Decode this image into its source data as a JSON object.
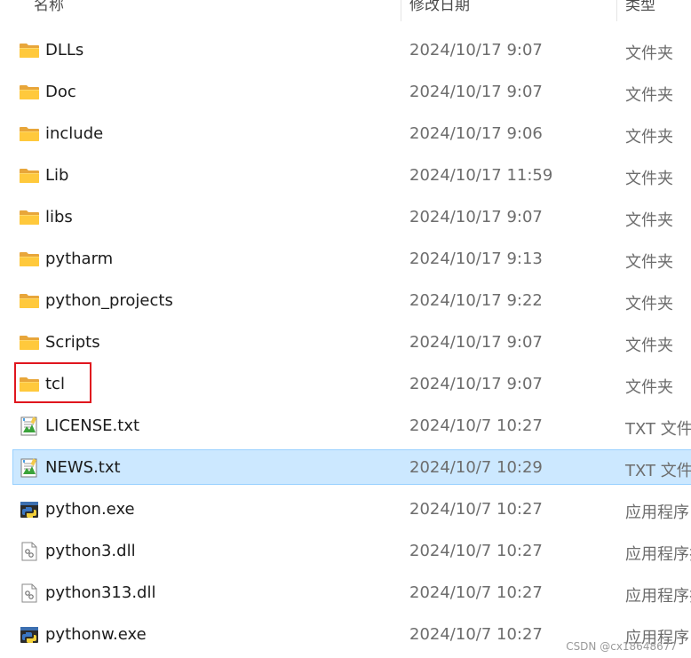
{
  "columns": {
    "name": "名称",
    "date": "修改日期",
    "type": "类型"
  },
  "files": [
    {
      "name": "DLLs",
      "date": "2024/10/17 9:07",
      "type": "文件夹",
      "icon": "folder-icon",
      "selected": false
    },
    {
      "name": "Doc",
      "date": "2024/10/17 9:07",
      "type": "文件夹",
      "icon": "folder-icon",
      "selected": false
    },
    {
      "name": "include",
      "date": "2024/10/17 9:06",
      "type": "文件夹",
      "icon": "folder-icon",
      "selected": false
    },
    {
      "name": "Lib",
      "date": "2024/10/17 11:59",
      "type": "文件夹",
      "icon": "folder-icon",
      "selected": false
    },
    {
      "name": "libs",
      "date": "2024/10/17 9:07",
      "type": "文件夹",
      "icon": "folder-icon",
      "selected": false
    },
    {
      "name": "pytharm",
      "date": "2024/10/17 9:13",
      "type": "文件夹",
      "icon": "folder-icon",
      "selected": false
    },
    {
      "name": "python_projects",
      "date": "2024/10/17 9:22",
      "type": "文件夹",
      "icon": "folder-icon",
      "selected": false
    },
    {
      "name": "Scripts",
      "date": "2024/10/17 9:07",
      "type": "文件夹",
      "icon": "folder-icon",
      "selected": false
    },
    {
      "name": "tcl",
      "date": "2024/10/17 9:07",
      "type": "文件夹",
      "icon": "folder-icon",
      "selected": false
    },
    {
      "name": "LICENSE.txt",
      "date": "2024/10/7 10:27",
      "type": "TXT 文件",
      "icon": "text-file-icon",
      "selected": false
    },
    {
      "name": "NEWS.txt",
      "date": "2024/10/7 10:29",
      "type": "TXT 文件",
      "icon": "text-file-icon",
      "selected": true
    },
    {
      "name": "python.exe",
      "date": "2024/10/7 10:27",
      "type": "应用程序",
      "icon": "python-exe-icon",
      "selected": false
    },
    {
      "name": "python3.dll",
      "date": "2024/10/7 10:27",
      "type": "应用程序扩展",
      "icon": "dll-file-icon",
      "selected": false
    },
    {
      "name": "python313.dll",
      "date": "2024/10/7 10:27",
      "type": "应用程序扩展",
      "icon": "dll-file-icon",
      "selected": false
    },
    {
      "name": "pythonw.exe",
      "date": "2024/10/7 10:27",
      "type": "应用程序",
      "icon": "python-exe-icon",
      "selected": false
    }
  ],
  "watermark": "CSDN @cx18648677"
}
